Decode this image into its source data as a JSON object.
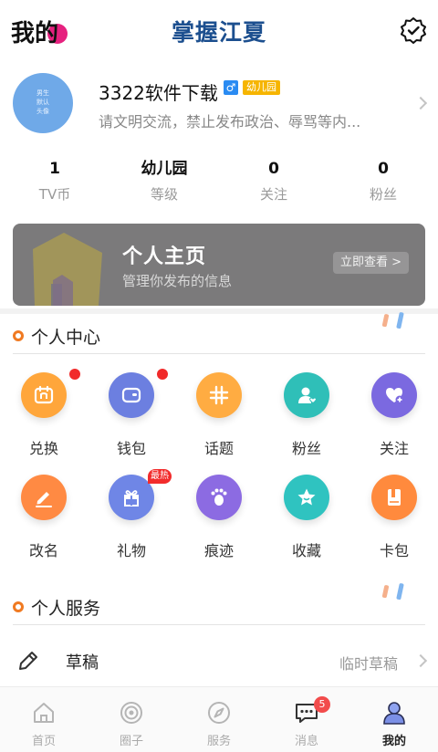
{
  "header": {
    "title": "我的",
    "brand": "掌握江夏",
    "badge_icon": "verified-badge-icon"
  },
  "profile": {
    "avatar_text": [
      "男生",
      "默认",
      "头像"
    ],
    "username": "3322软件下载",
    "gender_icon": "male-icon",
    "gender_glyph": "♂",
    "level_tag": "幼儿园",
    "motto": "请文明交流，禁止发布政治、辱骂等内..."
  },
  "stats": [
    {
      "value": "1",
      "label": "TV币"
    },
    {
      "value": "幼儿园",
      "label": "等级"
    },
    {
      "value": "0",
      "label": "关注"
    },
    {
      "value": "0",
      "label": "粉丝"
    }
  ],
  "banner": {
    "title": "个人主页",
    "subtitle": "管理你发布的信息",
    "button": "立即查看 >"
  },
  "personal_center": {
    "title": "个人中心",
    "items": [
      {
        "label": "兑换",
        "icon": "calendar-exchange-icon",
        "color": "#ffa63b",
        "dot": true
      },
      {
        "label": "钱包",
        "icon": "wallet-icon",
        "color": "#6c7fe0",
        "dot": true
      },
      {
        "label": "话题",
        "icon": "hashtag-icon",
        "color": "#ffac42"
      },
      {
        "label": "粉丝",
        "icon": "fan-user-icon",
        "color": "#2fbfb8"
      },
      {
        "label": "关注",
        "icon": "heart-plus-icon",
        "color": "#7b69e0"
      },
      {
        "label": "改名",
        "icon": "pencil-rename-icon",
        "color": "#ff8a43"
      },
      {
        "label": "礼物",
        "icon": "gift-icon",
        "color": "#6f86e6",
        "hot": "最热"
      },
      {
        "label": "痕迹",
        "icon": "footprint-icon",
        "color": "#8c6be2"
      },
      {
        "label": "收藏",
        "icon": "star-icon",
        "color": "#2fc3c0"
      },
      {
        "label": "卡包",
        "icon": "card-book-icon",
        "color": "#ff8a3d"
      }
    ]
  },
  "personal_service": {
    "title": "个人服务",
    "rows": [
      {
        "label": "草稿",
        "value": "临时草稿",
        "icon": "pen-icon"
      }
    ]
  },
  "nav": {
    "items": [
      {
        "label": "首页",
        "icon": "home-icon"
      },
      {
        "label": "圈子",
        "icon": "circle-target-icon"
      },
      {
        "label": "服务",
        "icon": "compass-icon"
      },
      {
        "label": "消息",
        "icon": "message-icon",
        "badge": "5"
      },
      {
        "label": "我的",
        "icon": "user-icon",
        "active": true
      }
    ]
  },
  "colors": {
    "brand": "#1c4f8f",
    "accent_orange": "#f07a22",
    "badge_red": "#f12a2a",
    "banner_bg": "#7b7a7b",
    "level_tag": "#f6b500"
  }
}
